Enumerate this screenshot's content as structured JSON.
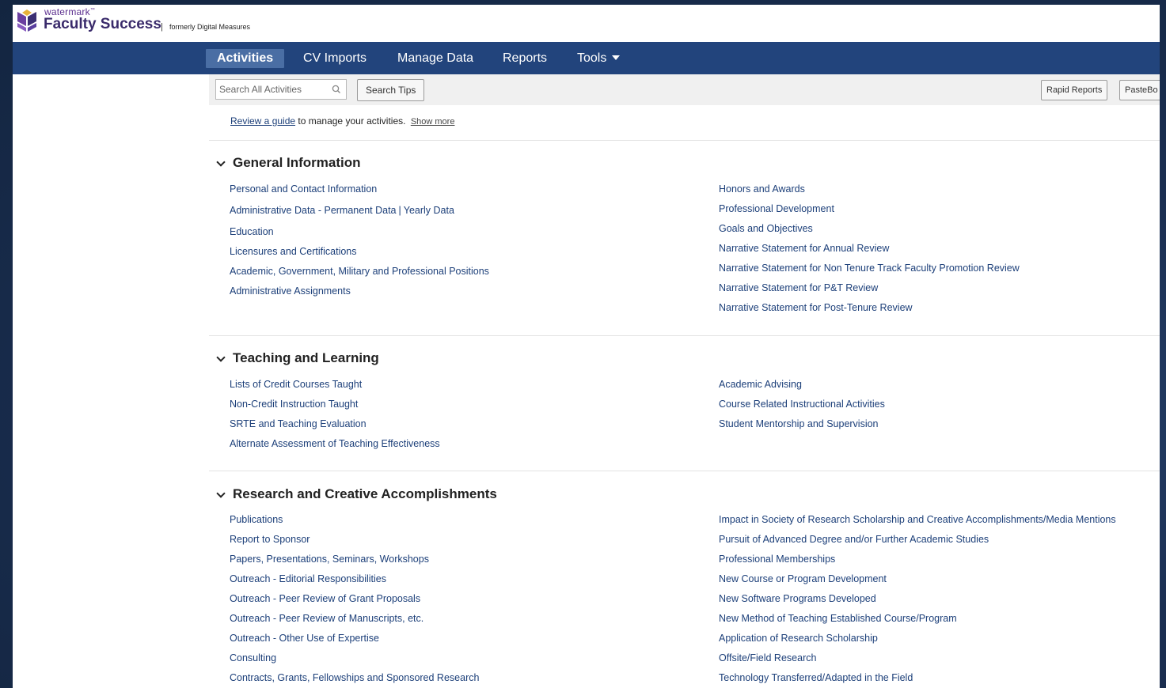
{
  "brand": {
    "small": "watermark",
    "tm": "™",
    "name": "Faculty Success",
    "separator": "|",
    "formerly": "formerly Digital Measures"
  },
  "nav": {
    "items": [
      "Activities",
      "CV Imports",
      "Manage Data",
      "Reports",
      "Tools"
    ],
    "active": "Activities"
  },
  "toolbar": {
    "search_placeholder": "Search All Activities",
    "search_tips": "Search Tips",
    "rapid_reports": "Rapid Reports",
    "pasteboard": "PasteBo"
  },
  "guide": {
    "link": "Review a guide",
    "text": " to manage your activities.",
    "show_more": "Show more"
  },
  "sections": {
    "general": {
      "title": "General Information",
      "left": [
        "Personal and Contact Information",
        "Administrative Data - Permanent Data",
        "Education",
        "Licensures and Certifications",
        "Academic, Government, Military and Professional Positions",
        "Administrative Assignments"
      ],
      "yearly": "Yearly Data",
      "right": [
        "Honors and Awards",
        "Professional Development",
        "Goals and Objectives",
        "Narrative Statement for Annual Review",
        "Narrative Statement for Non Tenure Track Faculty Promotion Review",
        "Narrative Statement for P&T Review",
        "Narrative Statement for Post-Tenure Review"
      ]
    },
    "teaching": {
      "title": "Teaching and Learning",
      "left": [
        "Lists of Credit Courses Taught",
        "Non-Credit Instruction Taught",
        "SRTE and Teaching Evaluation",
        "Alternate Assessment of Teaching Effectiveness"
      ],
      "right": [
        "Academic Advising",
        "Course Related Instructional Activities",
        "Student Mentorship and Supervision"
      ]
    },
    "research": {
      "title": "Research and Creative Accomplishments",
      "left": [
        "Publications",
        "Report to Sponsor",
        "Papers, Presentations, Seminars, Workshops",
        "Outreach - Editorial Responsibilities",
        "Outreach - Peer Review of Grant Proposals",
        "Outreach - Peer Review of Manuscripts, etc.",
        "Outreach - Other Use of Expertise",
        "Consulting",
        "Contracts, Grants, Fellowships and Sponsored Research"
      ],
      "right": [
        "Impact in Society of Research Scholarship and Creative Accomplishments/Media Mentions",
        "Pursuit of Advanced Degree and/or Further Academic Studies",
        "Professional Memberships",
        "New Course or Program Development",
        "New Software Programs Developed",
        "New Method of Teaching Established Course/Program",
        "Application of Research Scholarship",
        "Offsite/Field Research",
        "Technology Transferred/Adapted in the Field"
      ]
    }
  }
}
